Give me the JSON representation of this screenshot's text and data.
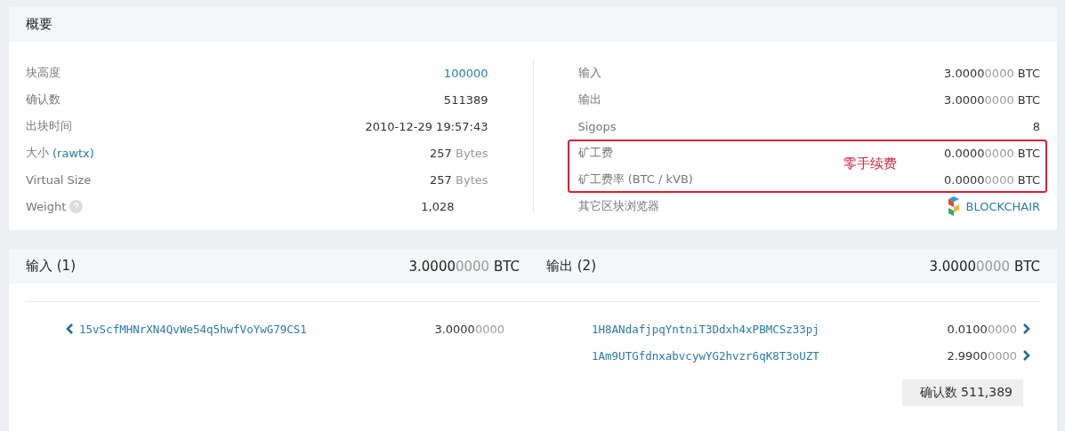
{
  "summary": {
    "title": "概要",
    "left_rows": [
      {
        "label": "块高度",
        "value": {
          "text": "100000",
          "kind": "link"
        }
      },
      {
        "label": "确认数",
        "value": {
          "text": "511389",
          "kind": "plain"
        }
      },
      {
        "label": "出块时间",
        "value": {
          "text": "2010-12-29 19:57:43",
          "kind": "plain"
        }
      },
      {
        "label": "大小",
        "label_link": "(rawtx)",
        "value": {
          "text": "257",
          "unit": "Bytes",
          "kind": "size"
        }
      },
      {
        "label": "Virtual Size",
        "value": {
          "text": "257",
          "unit": "Bytes",
          "kind": "size"
        }
      },
      {
        "label": "Weight",
        "help": true,
        "value": {
          "text": "1,028",
          "kind": "plain"
        }
      }
    ],
    "right_rows": [
      {
        "label": "输入",
        "highlighted": false,
        "value": {
          "kind": "amount",
          "main": "3.0000",
          "faded": "0000",
          "unit": "BTC"
        }
      },
      {
        "label": "输出",
        "highlighted": false,
        "value": {
          "kind": "amount",
          "main": "3.0000",
          "faded": "0000",
          "unit": "BTC"
        }
      },
      {
        "label": "Sigops",
        "highlighted": false,
        "value": {
          "kind": "plain",
          "text": "8"
        }
      },
      {
        "label": "矿工费",
        "highlighted": true,
        "value": {
          "kind": "amount",
          "main": "0.0000",
          "faded": "0000",
          "unit": "BTC"
        }
      },
      {
        "label": "矿工费率 (BTC / kVB)",
        "highlighted": true,
        "value": {
          "kind": "amount",
          "main": "0.0000",
          "faded": "0000",
          "unit": "BTC"
        }
      },
      {
        "label": "其它区块浏览器",
        "highlighted": false,
        "value": {
          "kind": "explorer",
          "text": "BLOCKCHAIR"
        }
      }
    ],
    "annotation": "零手续费"
  },
  "io": {
    "inputs": {
      "title": "输入 (1)",
      "total": {
        "main": "3.0000",
        "faded": "0000",
        "unit": "BTC"
      },
      "items": [
        {
          "address": "15vScfMHNrXN4QvWe54q5hwfVoYwG79CS1",
          "main": "3.0000",
          "faded": "0000"
        }
      ]
    },
    "outputs": {
      "title": "输出 (2)",
      "total": {
        "main": "3.0000",
        "faded": "0000",
        "unit": "BTC"
      },
      "items": [
        {
          "address": "1H8ANdafjpqYntniT3Ddxh4xPBMCSz33pj",
          "main": "0.0100",
          "faded": "0000"
        },
        {
          "address": "1Am9UTGfdnxabvcywYG2hvzr6qK8T3oUZT",
          "main": "2.9900",
          "faded": "0000"
        }
      ]
    },
    "confirmations": "确认数 511,389"
  }
}
